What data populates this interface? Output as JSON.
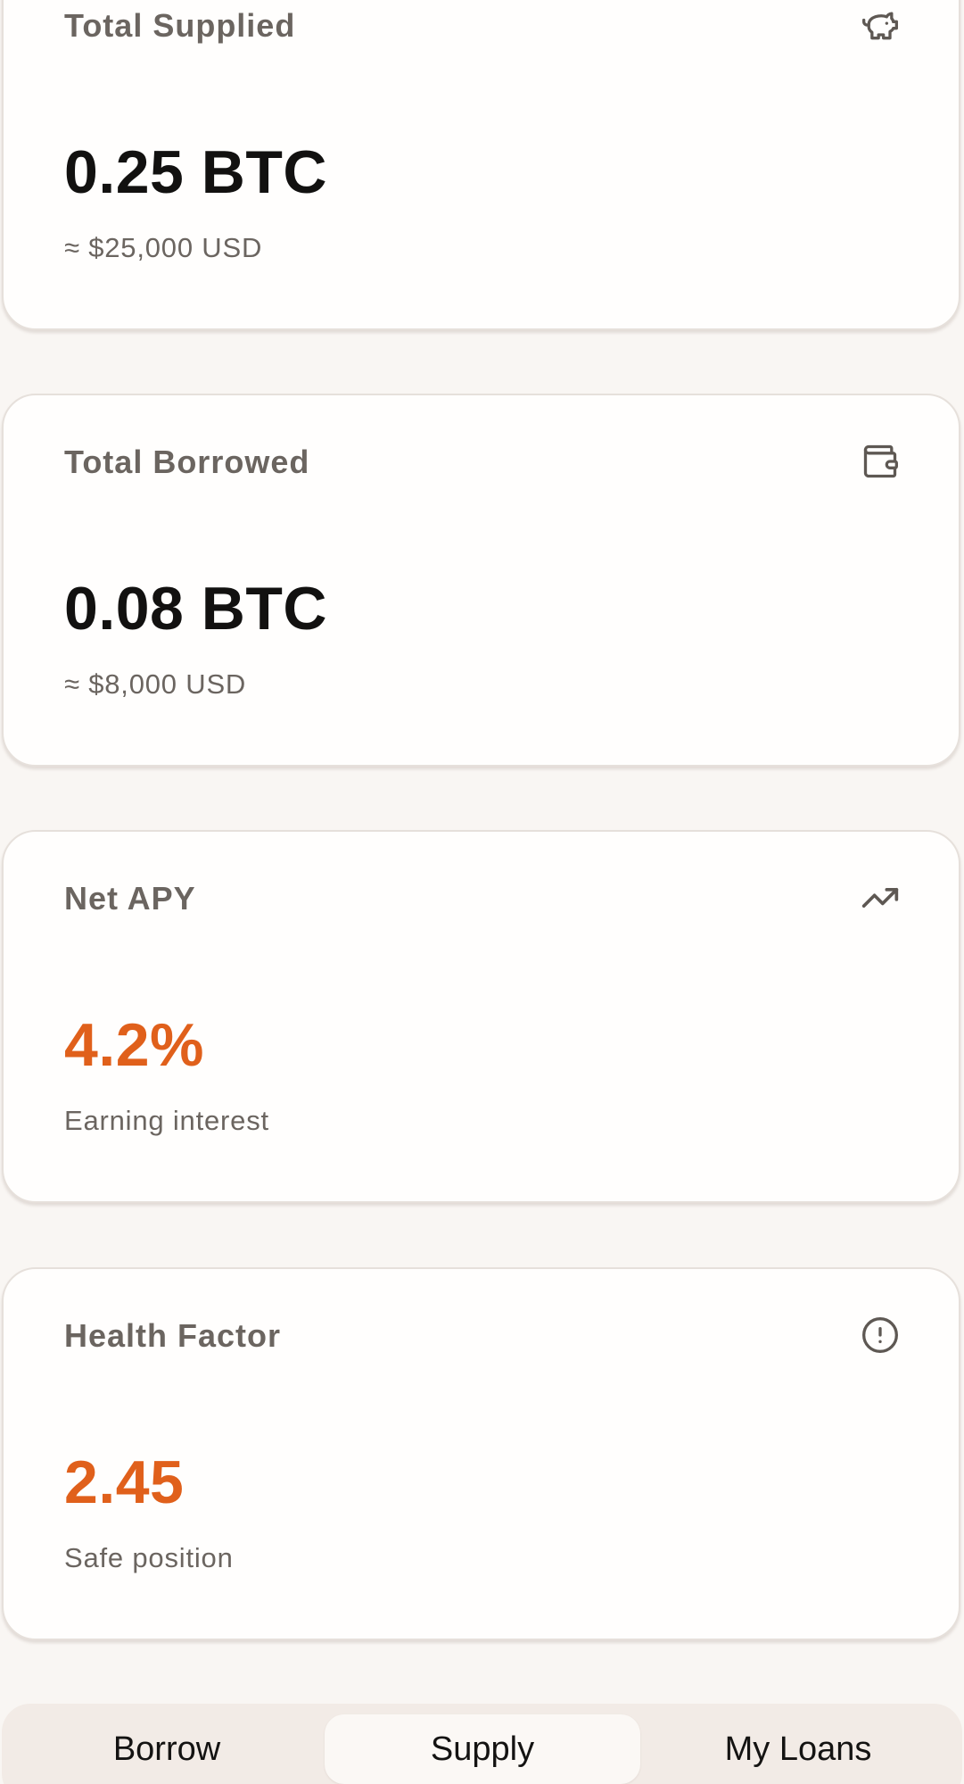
{
  "cards": [
    {
      "title": "Total Supplied",
      "icon": "piggy-bank-icon",
      "value": "0.25 BTC",
      "subtext": "≈ $25,000 USD"
    },
    {
      "title": "Total Borrowed",
      "icon": "wallet-icon",
      "value": "0.08 BTC",
      "subtext": "≈ $8,000 USD"
    },
    {
      "title": "Net APY",
      "icon": "trending-up-icon",
      "value": "4.2%",
      "subtext": "Earning interest"
    },
    {
      "title": "Health Factor",
      "icon": "alert-circle-icon",
      "value": "2.45",
      "subtext": "Safe position"
    }
  ],
  "tabs": [
    {
      "label": "Borrow"
    },
    {
      "label": "Supply"
    },
    {
      "label": "My Loans"
    }
  ],
  "active_tab": "Supply",
  "colors": {
    "accent": "#e0601b",
    "background": "#f9f6f3",
    "card": "#fffefd",
    "muted_text": "#6b6560"
  }
}
